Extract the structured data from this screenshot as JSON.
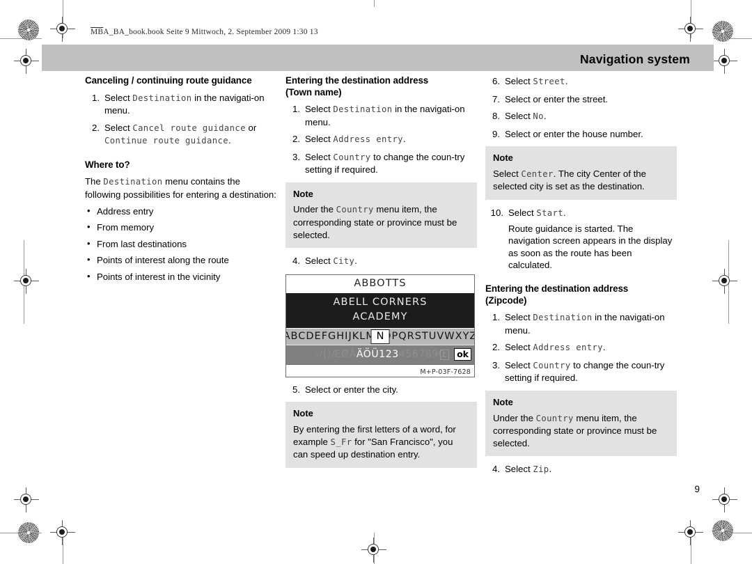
{
  "header": {
    "file_line_prefix": "MB",
    "file_line": "A_BA_book.book  Seite 9  Mittwoch, 2. September 2009  1:30 13",
    "title": "Navigation system",
    "page_number": "9"
  },
  "columns": {
    "left": {
      "section_1": {
        "heading": "Canceling / continuing route guidance",
        "steps": [
          {
            "num": "1.",
            "prefix": "Select ",
            "mono": "Destination",
            "suffix": " in the navigati-on menu."
          },
          {
            "num": "2.",
            "prefix": "Select ",
            "mono": "Cancel route guidance",
            "mid": " or ",
            "mono2": "Continue route guidance",
            "suffix": "."
          }
        ]
      },
      "section_2": {
        "heading": "Where to?",
        "intro_prefix": "The ",
        "intro_mono": "Destination",
        "intro_suffix": " menu contains the following possibilities for entering a destination:",
        "bullets": [
          "Address entry",
          "From memory",
          "From last destinations",
          "Points of interest along the route",
          "Points of interest in the vicinity"
        ]
      }
    },
    "middle": {
      "heading_line1": "Entering the destination address",
      "heading_line2": "(Town name)",
      "steps_1": [
        {
          "num": "1.",
          "prefix": "Select ",
          "mono": "Destination",
          "suffix": " in the navigati-on menu."
        },
        {
          "num": "2.",
          "prefix": "Select ",
          "mono": "Address entry",
          "suffix": "."
        },
        {
          "num": "3.",
          "prefix": "Select ",
          "mono": "Country",
          "suffix": " to change the coun-try setting if required."
        }
      ],
      "note_1": {
        "title": "Note",
        "prefix": "Under the ",
        "mono": "Country",
        "suffix": " menu item, the corresponding state or province must be selected."
      },
      "step_4": {
        "num": "4.",
        "prefix": "Select ",
        "mono": "City",
        "suffix": "."
      },
      "figure": {
        "top_entry": "ABBOTTS",
        "list_items": [
          "ABELL CORNERS",
          "ACADEMY"
        ],
        "alphabet_left": "ABCDEFGHIJKLM",
        "alphabet_selected": "N",
        "alphabet_right": "OPQRSTUVWXYZ",
        "symbols_dim_left": "-/()ÆØÅ",
        "symbols_on": "ÄÖÜ123",
        "symbols_dim_right": "4567890",
        "space_key": "⌴",
        "clear_key": "c",
        "ok_key": "ok",
        "code": "M+P-03F-7628"
      },
      "step_5": {
        "num": "5.",
        "text": "Select or enter the city."
      },
      "note_2": {
        "title": "Note",
        "prefix": "By entering the first letters of a word, for example ",
        "mono": "S_Fr",
        "suffix": " for \"San Francisco\", you can speed up destination entry."
      }
    },
    "right": {
      "steps_top": [
        {
          "num": "6.",
          "prefix": "Select ",
          "mono": "Street",
          "suffix": "."
        },
        {
          "num": "7.",
          "text": "Select or enter the street."
        },
        {
          "num": "8.",
          "prefix": "Select ",
          "mono": "No",
          "suffix": "."
        },
        {
          "num": "9.",
          "text": "Select or enter the house number."
        }
      ],
      "note_1": {
        "title": "Note",
        "prefix": "Select ",
        "mono": "Center",
        "suffix": ". The city Center of the selected city is set as the destination."
      },
      "step_10": {
        "num": "10.",
        "prefix": "Select ",
        "mono": "Start",
        "suffix": ".",
        "sub": "Route guidance is started. The navigation screen appears in the display as soon as the route has been calculated."
      },
      "heading_line1": "Entering the destination address",
      "heading_line2": "(Zipcode)",
      "steps_zip": [
        {
          "num": "1.",
          "prefix": "Select ",
          "mono": "Destination",
          "suffix": " in the navigati-on menu."
        },
        {
          "num": "2.",
          "prefix": "Select ",
          "mono": "Address entry",
          "suffix": "."
        },
        {
          "num": "3.",
          "prefix": "Select ",
          "mono": "Country",
          "suffix": " to change the coun-try setting if required."
        }
      ],
      "note_2": {
        "title": "Note",
        "prefix": "Under the ",
        "mono": "Country",
        "suffix": " menu item, the corresponding state or province must be selected."
      },
      "step_4": {
        "num": "4.",
        "prefix": "Select ",
        "mono": "Zip",
        "suffix": "."
      }
    }
  }
}
